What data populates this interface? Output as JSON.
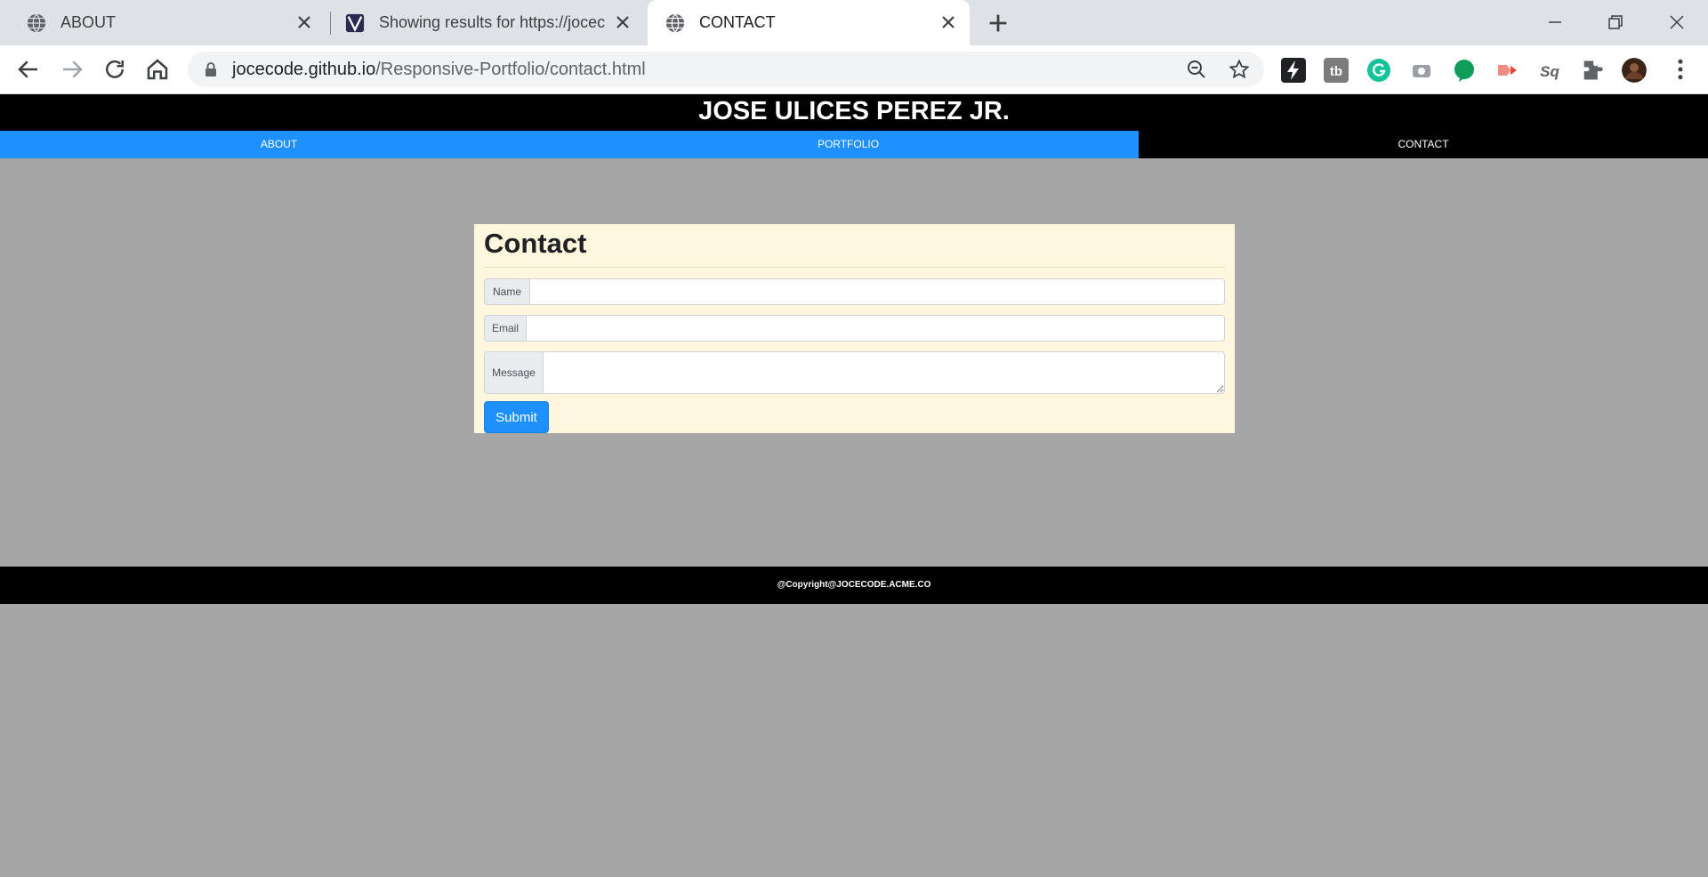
{
  "browser": {
    "tabs": [
      {
        "title": "ABOUT",
        "active": false
      },
      {
        "title": "Showing results for https://jocec",
        "active": false
      },
      {
        "title": "CONTACT",
        "active": true
      }
    ],
    "url": {
      "host": "jocecode.github.io",
      "path": "/Responsive-Portfolio/contact.html"
    }
  },
  "site": {
    "title": "JOSE ULICES PEREZ JR.",
    "nav": [
      {
        "label": "ABOUT",
        "active": false
      },
      {
        "label": "PORTFOLIO",
        "active": false
      },
      {
        "label": "CONTACT",
        "active": true
      }
    ],
    "colors": {
      "nav_bg": "#1e90ff",
      "nav_active_bg": "#000000",
      "page_bg": "#a6a6a6",
      "card_bg": "#fff7dd"
    }
  },
  "contact": {
    "heading": "Contact",
    "fields": {
      "name_label": "Name",
      "name_value": "",
      "email_label": "Email",
      "email_value": "",
      "message_label": "Message",
      "message_value": ""
    },
    "submit_label": "Submit"
  },
  "footer": {
    "text": "@Copyright@JOCECODE.ACME.CO"
  }
}
